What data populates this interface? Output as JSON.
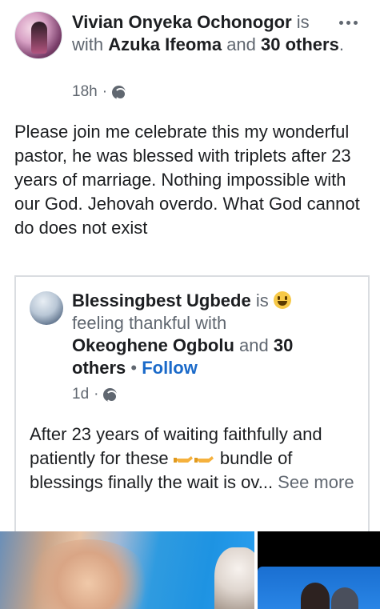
{
  "post": {
    "author": "Vivian Onyeka Ochonogor",
    "with_text": " is with ",
    "tagged": "Azuka Ifeoma",
    "and_text": " and ",
    "others": "30 others",
    "period": ".",
    "time": "18h",
    "dot": " · ",
    "privacy_icon": "globe-icon",
    "body": "Please join me celebrate this my wonderful pastor, he was blessed with triplets after 23 years of marriage. Nothing impossible with our God. Jehovah overdo. What God cannot do does not exist"
  },
  "shared": {
    "author": "Blessingbest Ugbede",
    "is_text": " is ",
    "feeling_icon": "grinning-face-emoji",
    "feeling_text": " feeling thankful with ",
    "tagged": "Okeoghene Ogbolu",
    "and_text": " and ",
    "others": "30 others",
    "period": ". ",
    "bullet": " • ",
    "follow": "Follow",
    "time": "1d",
    "dot": " · ",
    "privacy_icon": "globe-icon",
    "body_pre": "After 23 years of waiting faithfully and patiently for these ",
    "hands_icon": "pointing-hands-emoji",
    "body_post": " bundle of blessings finally the wait is ov... ",
    "see_more": "See more"
  },
  "colors": {
    "secondary_text": "#606770",
    "link_blue": "#1b6ac9",
    "border": "#dadde1"
  }
}
